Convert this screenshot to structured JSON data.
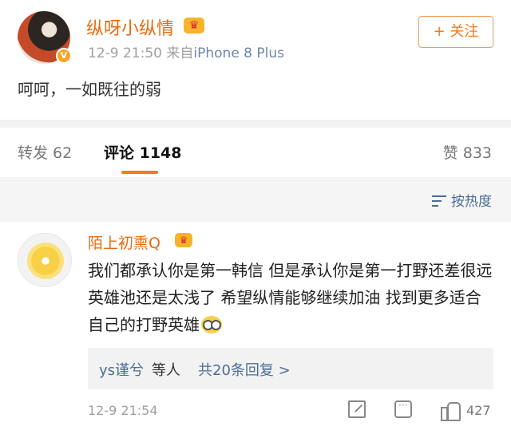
{
  "post": {
    "username": "纵呀小纵情",
    "badge_icon": "crown-vip-icon",
    "verified_icon": "verified-v-icon",
    "time": "12-9 21:50",
    "source_prefix": "来自",
    "source": "iPhone 8 Plus",
    "follow_label": "+ 关注",
    "text": "呵呵，一如既往的弱"
  },
  "tabs": {
    "repost": "转发 62",
    "comments": "评论 1148",
    "likes": "赞 833"
  },
  "sort": {
    "label": "按热度"
  },
  "comment": {
    "username": "陌上初熏Q",
    "text": "我们都承认你是第一韩信 但是承认你是第一打野还差很远 英雄池还是太浅了 希望纵情能够继续加油 找到更多适合自己的打野英雄",
    "reply_users": "ys谨兮",
    "reply_suffix": "等人",
    "reply_count": "共20条回复 >",
    "time": "12-9 21:54",
    "like_count": "427"
  },
  "colors": {
    "accent_orange": "#f07a20",
    "link_blue": "#4a6d96"
  }
}
